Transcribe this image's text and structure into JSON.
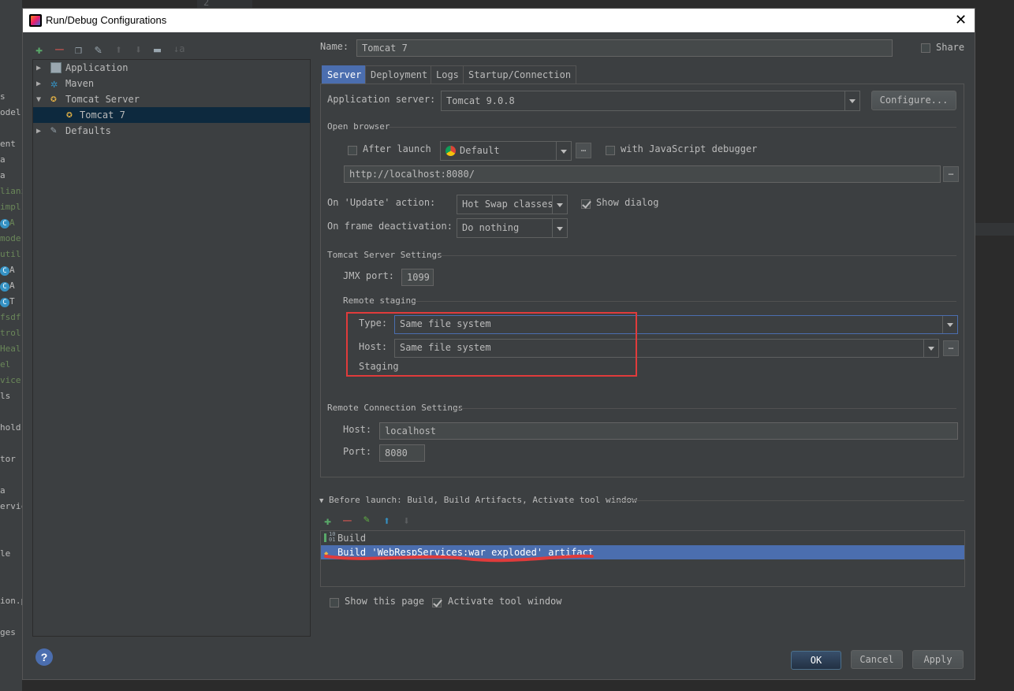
{
  "background": {
    "line_number": "2",
    "left_items": [
      "s",
      "odel",
      "",
      "ent",
      "a",
      "a",
      "lianz",
      "impl",
      "A",
      "mode",
      "util",
      "A",
      "A",
      "T",
      "fsdf",
      "trol",
      "Heal",
      "el",
      "vice",
      "ls",
      "",
      "hold",
      "",
      "tor",
      "",
      "a",
      "ervic",
      "",
      "",
      "le",
      "",
      "",
      "ion.p",
      "",
      "ges"
    ]
  },
  "dialog": {
    "title": "Run/Debug Configurations",
    "close_label": "✕"
  },
  "toolbar_icons": [
    "plus-icon",
    "minus-icon",
    "copy-icon",
    "wrench-icon",
    "arrow-up-icon",
    "arrow-down-icon",
    "folder-icon",
    "sort-icon"
  ],
  "tree": {
    "items": [
      {
        "label": "Application",
        "level": 0,
        "expanded": false,
        "icon": "application-icon",
        "selected": false
      },
      {
        "label": "Maven",
        "level": 0,
        "expanded": false,
        "icon": "maven-gear-icon",
        "selected": false
      },
      {
        "label": "Tomcat Server",
        "level": 0,
        "expanded": true,
        "icon": "tomcat-icon",
        "selected": false
      },
      {
        "label": "Tomcat 7",
        "level": 1,
        "expanded": false,
        "icon": "tomcat-icon",
        "selected": true
      },
      {
        "label": "Defaults",
        "level": 0,
        "expanded": false,
        "icon": "wrench-icon",
        "selected": false
      }
    ]
  },
  "name": {
    "label": "Name:",
    "value": "Tomcat 7"
  },
  "share": {
    "label": "Share",
    "checked": false
  },
  "tabs": [
    "Server",
    "Deployment",
    "Logs",
    "Startup/Connection"
  ],
  "active_tab": "Server",
  "server": {
    "app_server_label": "Application server:",
    "app_server_value": "Tomcat 9.0.8",
    "configure_label": "Configure...",
    "open_browser_title": "Open browser",
    "after_launch_label": "After launch",
    "after_launch_checked": false,
    "browser_value": "Default",
    "js_debugger_label": "with JavaScript debugger",
    "js_debugger_checked": false,
    "url": "http://localhost:8080/",
    "on_update_label": "On 'Update' action:",
    "on_update_value": "Hot Swap classes",
    "show_dialog_label": "Show dialog",
    "show_dialog_checked": true,
    "on_frame_label": "On frame deactivation:",
    "on_frame_value": "Do nothing",
    "tomcat_settings_title": "Tomcat Server Settings",
    "jmx_label": "JMX port:",
    "jmx_value": "1099",
    "remote_staging_title": "Remote staging",
    "type_label": "Type:",
    "type_value": "Same file system",
    "host_label": "Host:",
    "host_value": "Same file system",
    "staging_label": "Staging",
    "remote_conn_title": "Remote Connection Settings",
    "rc_host_label": "Host:",
    "rc_host_value": "localhost",
    "rc_port_label": "Port:",
    "rc_port_value": "8080"
  },
  "before_launch": {
    "title": "Before launch: Build, Build Artifacts, Activate tool window",
    "items": [
      "Build",
      "Build 'WebRespServices:war exploded' artifact"
    ],
    "show_page_label": "Show this page",
    "show_page_checked": false,
    "activate_label": "Activate tool window",
    "activate_checked": true
  },
  "buttons": {
    "ok": "OK",
    "cancel": "Cancel",
    "apply": "Apply",
    "help": "?"
  },
  "colors": {
    "accent": "#4b6eaf",
    "annotation": "#e03b3b",
    "add": "#59a869",
    "remove": "#c75450"
  }
}
